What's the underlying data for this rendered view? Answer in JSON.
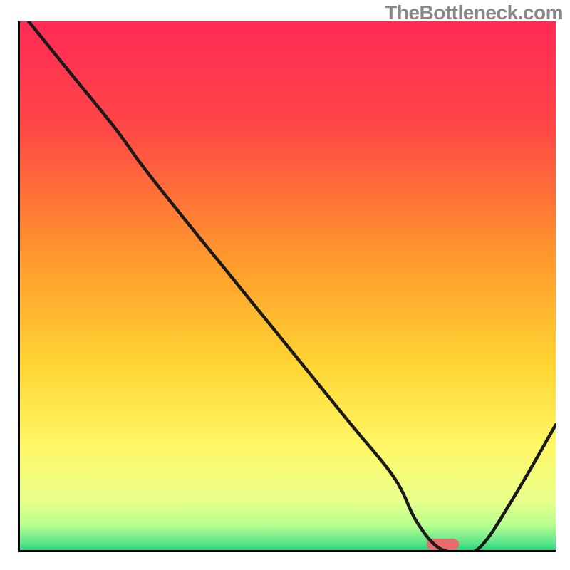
{
  "watermark": "TheBottleneck.com",
  "chart_data": {
    "type": "line",
    "title": "",
    "xlabel": "",
    "ylabel": "",
    "xlim": [
      0,
      100
    ],
    "ylim": [
      0,
      100
    ],
    "x": [
      2,
      10,
      18,
      23,
      30,
      38,
      46,
      54,
      62,
      70,
      74,
      78,
      82,
      86,
      92,
      100
    ],
    "values": [
      100,
      90,
      80,
      73,
      64,
      54,
      44,
      34,
      24,
      14,
      6,
      1,
      0,
      1,
      10,
      24
    ],
    "optimum_range_x": [
      76,
      82
    ],
    "gradient_stops": [
      {
        "offset": 0.0,
        "color": "#ff2a55"
      },
      {
        "offset": 0.2,
        "color": "#ff4746"
      },
      {
        "offset": 0.45,
        "color": "#ff9a2c"
      },
      {
        "offset": 0.65,
        "color": "#ffd633"
      },
      {
        "offset": 0.8,
        "color": "#fff766"
      },
      {
        "offset": 0.9,
        "color": "#eaff8a"
      },
      {
        "offset": 0.95,
        "color": "#b6ff8f"
      },
      {
        "offset": 0.985,
        "color": "#55e38a"
      },
      {
        "offset": 1.0,
        "color": "#18c76f"
      }
    ],
    "optimum_marker_color": "#e86b6b",
    "curve_stroke": "#1a1a1a",
    "frame_stroke": "#000000"
  }
}
